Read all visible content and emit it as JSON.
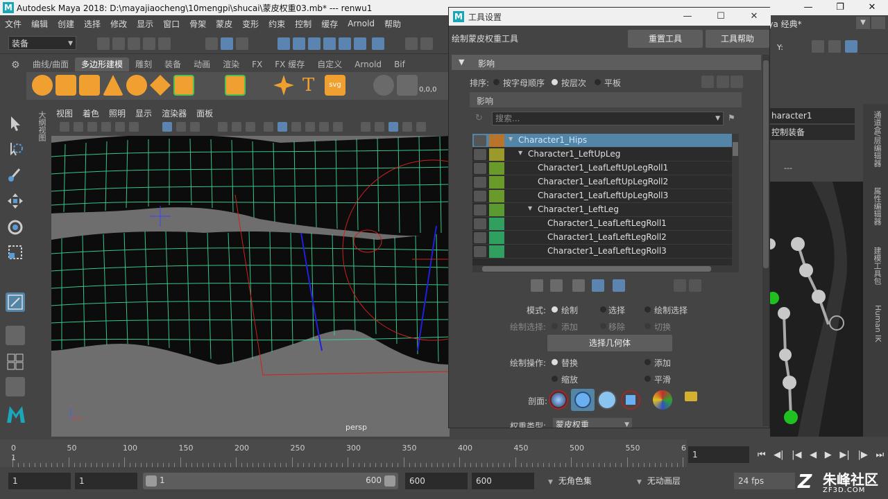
{
  "window": {
    "title": "Autodesk Maya 2018: D:\\mayajiaocheng\\10mengpi\\shucai\\蒙皮权重03.mb*   ---   renwu1",
    "app_icon": "M"
  },
  "menubar": {
    "items": [
      "文件",
      "编辑",
      "创建",
      "选择",
      "修改",
      "显示",
      "窗口",
      "骨架",
      "蒙皮",
      "变形",
      "约束",
      "控制",
      "缓存",
      "Arnold",
      "帮助"
    ],
    "workspace": "aya 经典*"
  },
  "statusline": {
    "mode": "装备"
  },
  "shelf": {
    "tabs": [
      "曲线/曲面",
      "多边形建模",
      "雕刻",
      "装备",
      "动画",
      "渲染",
      "FX",
      "FX 缓存",
      "自定义",
      "Arnold",
      "Bif"
    ],
    "active_tab": "多边形建模",
    "readout": "0,0,0"
  },
  "viewport": {
    "menu": [
      "视图",
      "着色",
      "照明",
      "显示",
      "渲染器",
      "面板"
    ],
    "camera": "persp",
    "side_label": "大纲视图"
  },
  "tool_settings": {
    "window_title": "工具设置",
    "tool_name": "绘制蒙皮权重工具",
    "reset_button": "重置工具",
    "help_button": "工具帮助",
    "section_influence": "影响",
    "sort_label": "排序:",
    "sort_options": [
      "按字母顺序",
      "按层次",
      "平板"
    ],
    "sort_selected": 1,
    "influence_sub": "影响",
    "search_placeholder": "搜索...",
    "joints": [
      {
        "name": "Character1_Hips",
        "indent": 0,
        "expand": true,
        "color": "#b8742a",
        "selected": true
      },
      {
        "name": "Character1_LeftUpLeg",
        "indent": 1,
        "expand": true,
        "color": "#9a9a2a",
        "selected": false
      },
      {
        "name": "Character1_LeafLeftUpLegRoll1",
        "indent": 2,
        "expand": false,
        "color": "#6a9a2a",
        "selected": false
      },
      {
        "name": "Character1_LeafLeftUpLegRoll2",
        "indent": 2,
        "expand": false,
        "color": "#6a9a2a",
        "selected": false
      },
      {
        "name": "Character1_LeafLeftUpLegRoll3",
        "indent": 2,
        "expand": false,
        "color": "#6a9a2a",
        "selected": false
      },
      {
        "name": "Character1_LeftLeg",
        "indent": 2,
        "expand": true,
        "color": "#5a9a30",
        "selected": false
      },
      {
        "name": "Character1_LeafLeftLegRoll1",
        "indent": 3,
        "expand": false,
        "color": "#30a060",
        "selected": false
      },
      {
        "name": "Character1_LeafLeftLegRoll2",
        "indent": 3,
        "expand": false,
        "color": "#30a060",
        "selected": false
      },
      {
        "name": "Character1_LeafLeftLegRoll3",
        "indent": 3,
        "expand": false,
        "color": "#30a060",
        "selected": false
      }
    ],
    "mode_label": "模式:",
    "mode_options": [
      "绘制",
      "选择",
      "绘制选择"
    ],
    "mode_selected": 0,
    "paint_select_label": "绘制选择:",
    "paint_select_options": [
      "添加",
      "移除",
      "切换"
    ],
    "select_geometry_button": "选择几何体",
    "paint_op_label": "绘制操作:",
    "paint_op_options": [
      "替换",
      "添加",
      "缩放",
      "平滑"
    ],
    "paint_op_selected": 0,
    "profile_label": "剖面:",
    "weight_type_label": "权重类型:",
    "weight_type_value": "蒙皮权重"
  },
  "right_panel": {
    "character": "haracter1",
    "rig_dropdown": "控制装备",
    "dashes": "---",
    "tabs": [
      "通道盒/层编辑器",
      "属性编辑器",
      "建模工具包",
      "Human IK"
    ]
  },
  "timeline": {
    "ticks": [
      "0",
      "50",
      "100",
      "150",
      "200",
      "250",
      "300",
      "350",
      "400",
      "450",
      "500",
      "550",
      "6"
    ],
    "current_frame": "1",
    "frame_field": "1"
  },
  "range": {
    "start": "1",
    "playback_start": "1",
    "slider_start": "1",
    "slider_end": "600",
    "playback_end": "600",
    "end": "600",
    "character_set": "无角色集",
    "anim_layer": "无动画层",
    "fps": "24 fps"
  },
  "watermark": {
    "name": "朱峰社区",
    "url": "ZF3D.COM"
  },
  "colors": {
    "selection_blue": "#5285a6",
    "mesh_green": "#3ddc97",
    "maya_teal": "#1aa5b8"
  }
}
